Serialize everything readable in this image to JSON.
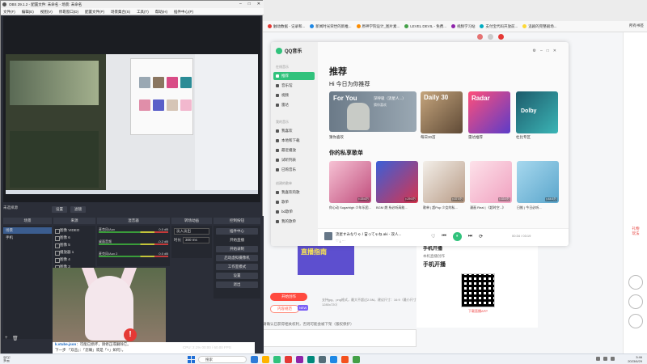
{
  "browser": {
    "bookmarks": [
      "触动数据 - 记录和...",
      "新闻时光荣世的新推...",
      "原神学院设计_图片素...",
      "LEVEL DEVIL - 免费...",
      "视频学习站",
      "支付宝代码开放前...",
      "追剧的完整剧场..."
    ],
    "bookmarks_right": "所有书签",
    "right_rail": [
      "礼物",
      "玩法"
    ],
    "stream_section": {
      "heading": "手机开播",
      "subtitle": "本机直播创作",
      "title": "手机开播",
      "qr_label": "下载直播APP"
    },
    "banner": "直播指南",
    "start_button": "开始创作",
    "spec_button": "内容规范",
    "new_badge": "NEW",
    "format_note": "支持jpg、png格式，最大不超过2.5M，建议尺寸：16:9（最小尺寸1280x720）",
    "license_note": "请确认已获得相关权利，否则可能会被下架（版权保护）"
  },
  "qq": {
    "logo": "QQ音乐",
    "nav_section1": "在线音乐",
    "nav1": [
      "推荐",
      "音乐馆",
      "视频",
      "雷达"
    ],
    "nav_section2": "我的音乐",
    "nav2": [
      "我喜欢",
      "本地和下载",
      "最近播放",
      "试听列表",
      "已购音乐"
    ],
    "nav_section3": "创建的歌单",
    "nav3": [
      "我喜欢的歌",
      "歌单",
      "bd歌单",
      "我的歌单"
    ],
    "title": "推荐",
    "greeting": "Hi 今日为你推荐",
    "foryou": {
      "label": "For You",
      "song": "深呼吸（流星人...）",
      "artist": "猜你喜欢"
    },
    "daily": "Daily 30",
    "radar": "Radar",
    "dolby": "Dolby",
    "card_titles": [
      "猜你喜欢",
      "每日30首",
      "雷达推荐",
      "杜比专区"
    ],
    "private_title": "你的私享歌单",
    "playlists": [
      {
        "count": "▷15.6万",
        "title": "你心动 Sugarhigh 少年乐团..."
      },
      {
        "count": "▷29.5万",
        "title": "BGM 燃 系必听高能..."
      },
      {
        "count": "▷37.5万",
        "title": "歌单 | 超Pop 少女的私..."
      },
      {
        "count": "▷33.9万",
        "title": "漫画 Real | 《超时空...》"
      },
      {
        "count": "▷44.5万",
        "title": "日推 | 今日必听..."
      }
    ],
    "player": {
      "song": "流星すみなりゃ / 宙ってゃね aki - 双人...",
      "time": "00:34 / 03:19",
      "controls": [
        "♡",
        "⏮",
        "⏸",
        "⏭",
        "⟳"
      ]
    }
  },
  "obs": {
    "title": "OBS 29.1.2 - 配置文件: 未命名 - 场景: 未命名",
    "menu": [
      "文件(F)",
      "编辑(E)",
      "视图(V)",
      "停靠窗口(D)",
      "配置文件(P)",
      "场景集合(S)",
      "工具(T)",
      "帮助(H)",
      "插件中心(P)"
    ],
    "scene_tab_label": "未选择源",
    "tabs": [
      "设置",
      "滤镜"
    ],
    "docks": [
      "场景",
      "来源",
      "混音器",
      "转场动画",
      "控制按钮"
    ],
    "scenes": [
      "场景",
      "手机"
    ],
    "sources": [
      "图像 VIDEO",
      "图像 6",
      "图像 5",
      "播放器 1",
      "图像 4",
      "图像 3",
      "图像 2",
      "图像 1",
      "图像",
      "窗口",
      "录像",
      "采集"
    ],
    "mixer": [
      {
        "label": "麦克风/Aux",
        "db": "0.0 dB"
      },
      {
        "label": "桌面音频",
        "db": "-0.2 dB"
      },
      {
        "label": "麦克风/Aux 2",
        "db": "0.0 dB"
      }
    ],
    "transition": {
      "selected": "淡入淡出",
      "duration_label": "时长",
      "duration": "300 ms"
    },
    "controls": [
      "插件中心",
      "开始直播",
      "开始录制",
      "启动虚拟摄像机",
      "工作室模式",
      "设置",
      "退出"
    ],
    "vtuber_title": "k.vtube.json",
    "vtuber_msg": "：可能已损坏，请修正或删除它。",
    "vtuber_msg2": "下一步 「双击」：「您确」或是「×」如何）。",
    "status": "CPU: 2.1%   00:00 / 60.00 FPS"
  },
  "taskbar": {
    "weather": "28°C\n多云",
    "search": "搜索",
    "time": "3:46",
    "date": "2023/6/29",
    "app_colors": [
      "#2d7bd8",
      "#ffb300",
      "#31c27c",
      "#e53935",
      "#8e24aa",
      "#00897b",
      "#546e7a",
      "#1e88e5",
      "#f4511e",
      "#43a047"
    ]
  }
}
